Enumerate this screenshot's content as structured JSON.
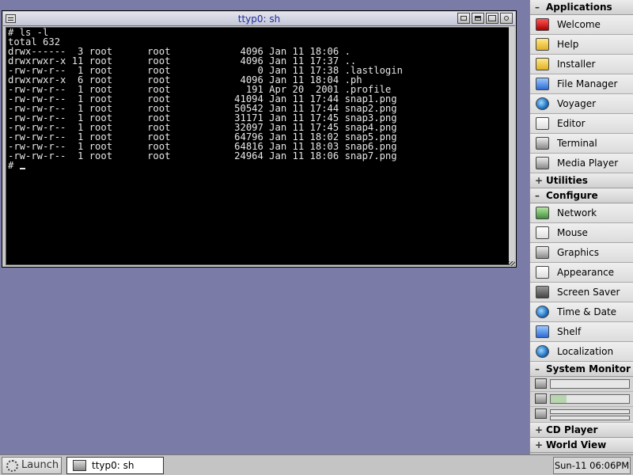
{
  "window": {
    "title": "ttyp0: sh",
    "lines": [
      "# ls -l",
      "total 632",
      "drwx------  3 root      root            4096 Jan 11 18:06 .",
      "drwxrwxr-x 11 root      root            4096 Jan 11 17:37 ..",
      "-rw-rw-r--  1 root      root               0 Jan 11 17:38 .lastlogin",
      "drwxrwxr-x  6 root      root            4096 Jan 11 18:04 .ph",
      "-rw-rw-r--  1 root      root             191 Apr 20  2001 .profile",
      "-rw-rw-r--  1 root      root           41094 Jan 11 17:44 snap1.png",
      "-rw-rw-r--  1 root      root           50542 Jan 11 17:44 snap2.png",
      "-rw-rw-r--  1 root      root           31171 Jan 11 17:45 snap3.png",
      "-rw-rw-r--  1 root      root           32097 Jan 11 17:45 snap4.png",
      "-rw-rw-r--  1 root      root           64796 Jan 11 18:02 snap5.png",
      "-rw-rw-r--  1 root      root           64816 Jan 11 18:03 snap6.png",
      "-rw-rw-r--  1 root      root           24964 Jan 11 18:06 snap7.png"
    ],
    "prompt": "# "
  },
  "dock": {
    "applications": {
      "label": "Applications",
      "toggle": "–",
      "items": [
        {
          "label": "Welcome",
          "icon": "welcome-icon"
        },
        {
          "label": "Help",
          "icon": "help-icon"
        },
        {
          "label": "Installer",
          "icon": "installer-icon"
        },
        {
          "label": "File Manager",
          "icon": "file-manager-icon"
        },
        {
          "label": "Voyager",
          "icon": "voyager-icon"
        },
        {
          "label": "Editor",
          "icon": "editor-icon"
        },
        {
          "label": "Terminal",
          "icon": "terminal-icon"
        },
        {
          "label": "Media Player",
          "icon": "media-player-icon"
        }
      ]
    },
    "utilities": {
      "label": "Utilities",
      "toggle": "+"
    },
    "configure": {
      "label": "Configure",
      "toggle": "–",
      "items": [
        {
          "label": "Network",
          "icon": "network-icon"
        },
        {
          "label": "Mouse",
          "icon": "mouse-icon"
        },
        {
          "label": "Graphics",
          "icon": "graphics-icon"
        },
        {
          "label": "Appearance",
          "icon": "appearance-icon"
        },
        {
          "label": "Screen Saver",
          "icon": "screen-saver-icon"
        },
        {
          "label": "Time & Date",
          "icon": "time-date-icon"
        },
        {
          "label": "Shelf",
          "icon": "shelf-icon"
        },
        {
          "label": "Localization",
          "icon": "localization-icon"
        }
      ]
    },
    "system_monitor": {
      "label": "System Monitor",
      "toggle": "–",
      "cpu_level": 0,
      "memory_level": 0.2
    },
    "cd_player": {
      "label": "CD Player",
      "toggle": "+"
    },
    "world_view": {
      "label": "World View",
      "toggle": "+"
    }
  },
  "taskbar": {
    "launch_label": "Launch",
    "task_label": "ttyp0: sh",
    "clock": "Sun-11  06:06PM"
  }
}
